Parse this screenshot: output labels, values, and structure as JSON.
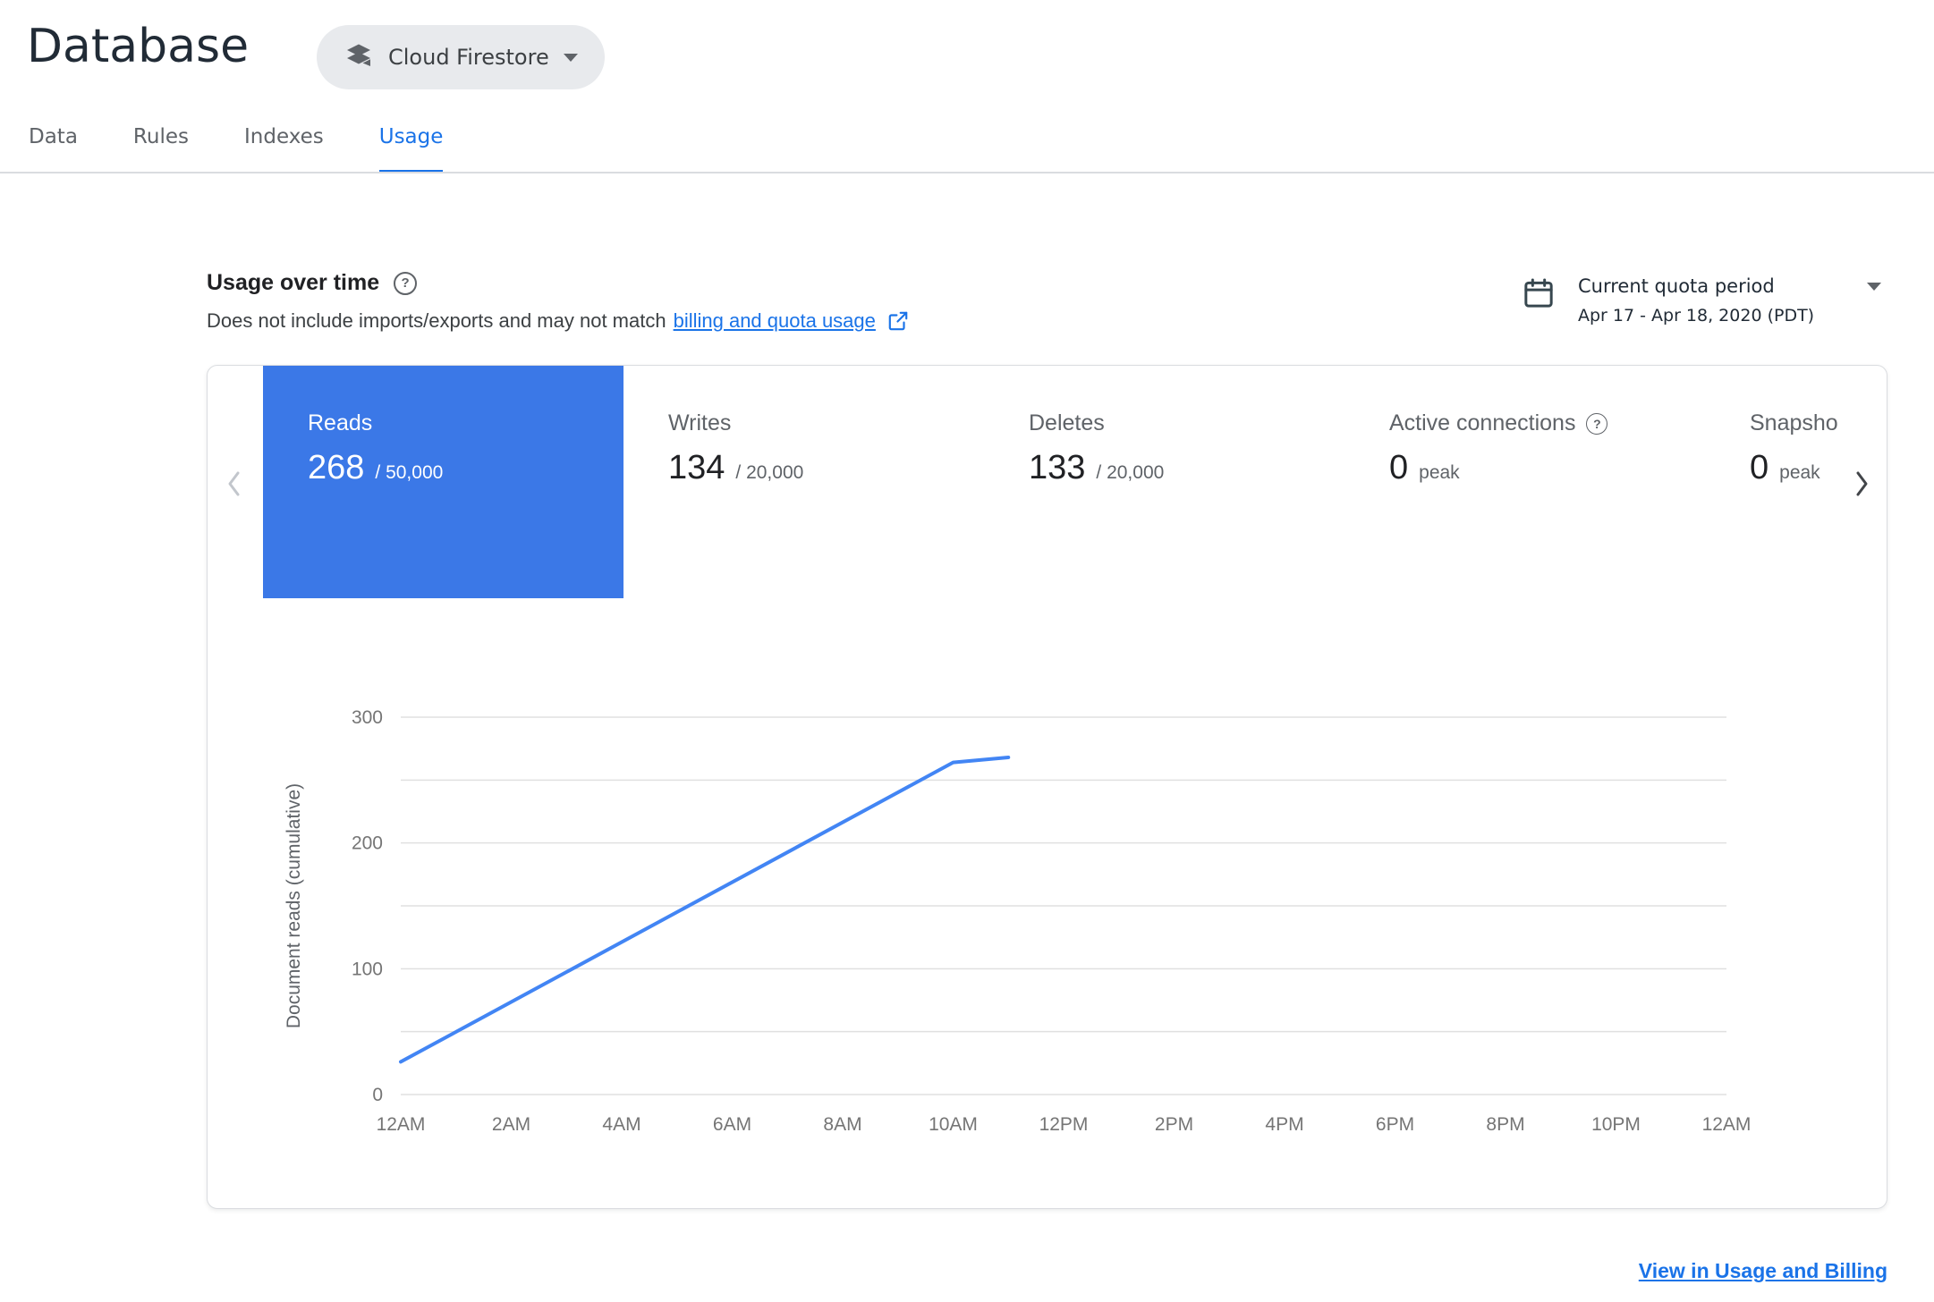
{
  "page": {
    "title": "Database"
  },
  "product_selector": {
    "label": "Cloud Firestore"
  },
  "tabs": {
    "items": [
      {
        "label": "Data"
      },
      {
        "label": "Rules"
      },
      {
        "label": "Indexes"
      },
      {
        "label": "Usage"
      }
    ],
    "active": "Usage"
  },
  "usage": {
    "title": "Usage over time",
    "desc_prefix": "Does not include imports/exports and may not match ",
    "desc_link": "billing and quota usage",
    "quota_period": {
      "label": "Current quota period",
      "range": "Apr 17 - Apr 18, 2020 (PDT)"
    }
  },
  "metrics": [
    {
      "label": "Reads",
      "value": "268",
      "suffix": "/ 50,000",
      "selected": true
    },
    {
      "label": "Writes",
      "value": "134",
      "suffix": "/ 20,000",
      "selected": false
    },
    {
      "label": "Deletes",
      "value": "133",
      "suffix": "/ 20,000",
      "selected": false
    },
    {
      "label": "Active connections",
      "value": "0",
      "suffix": "peak",
      "selected": false
    },
    {
      "label": "Snapshot listeners",
      "value": "0",
      "suffix": "peak",
      "selected": false
    }
  ],
  "footer_link": "View in Usage and Billing",
  "icons": {
    "help": "?"
  },
  "colors": {
    "accent": "#1a73e8",
    "tile_blue": "#3b78e7",
    "text_dark": "#202124",
    "text_gray": "#5f6368",
    "divider": "#dadce0",
    "pill_bg": "#e8eaed"
  },
  "chart_data": {
    "type": "line",
    "title": "",
    "xlabel": "",
    "ylabel": "Document reads (cumulative)",
    "x_range_hours": [
      0,
      24
    ],
    "x_ticks": [
      {
        "h": 0,
        "label": "12AM"
      },
      {
        "h": 2,
        "label": "2AM"
      },
      {
        "h": 4,
        "label": "4AM"
      },
      {
        "h": 6,
        "label": "6AM"
      },
      {
        "h": 8,
        "label": "8AM"
      },
      {
        "h": 10,
        "label": "10AM"
      },
      {
        "h": 12,
        "label": "12PM"
      },
      {
        "h": 14,
        "label": "2PM"
      },
      {
        "h": 16,
        "label": "4PM"
      },
      {
        "h": 18,
        "label": "6PM"
      },
      {
        "h": 20,
        "label": "8PM"
      },
      {
        "h": 22,
        "label": "10PM"
      },
      {
        "h": 24,
        "label": "12AM"
      }
    ],
    "ylim": [
      0,
      300
    ],
    "y_gridline_step": 50,
    "y_tick_labels": [
      0,
      100,
      200,
      300
    ],
    "grid": "horizontal",
    "grid_color": "#e0e0e0",
    "tick_color": "#757575",
    "legend": "none",
    "series": [
      {
        "name": "Document reads (cumulative)",
        "color": "#4285f4",
        "points": [
          {
            "x": 0,
            "y": 26
          },
          {
            "x": 10,
            "y": 264
          },
          {
            "x": 11,
            "y": 268
          }
        ]
      }
    ]
  }
}
